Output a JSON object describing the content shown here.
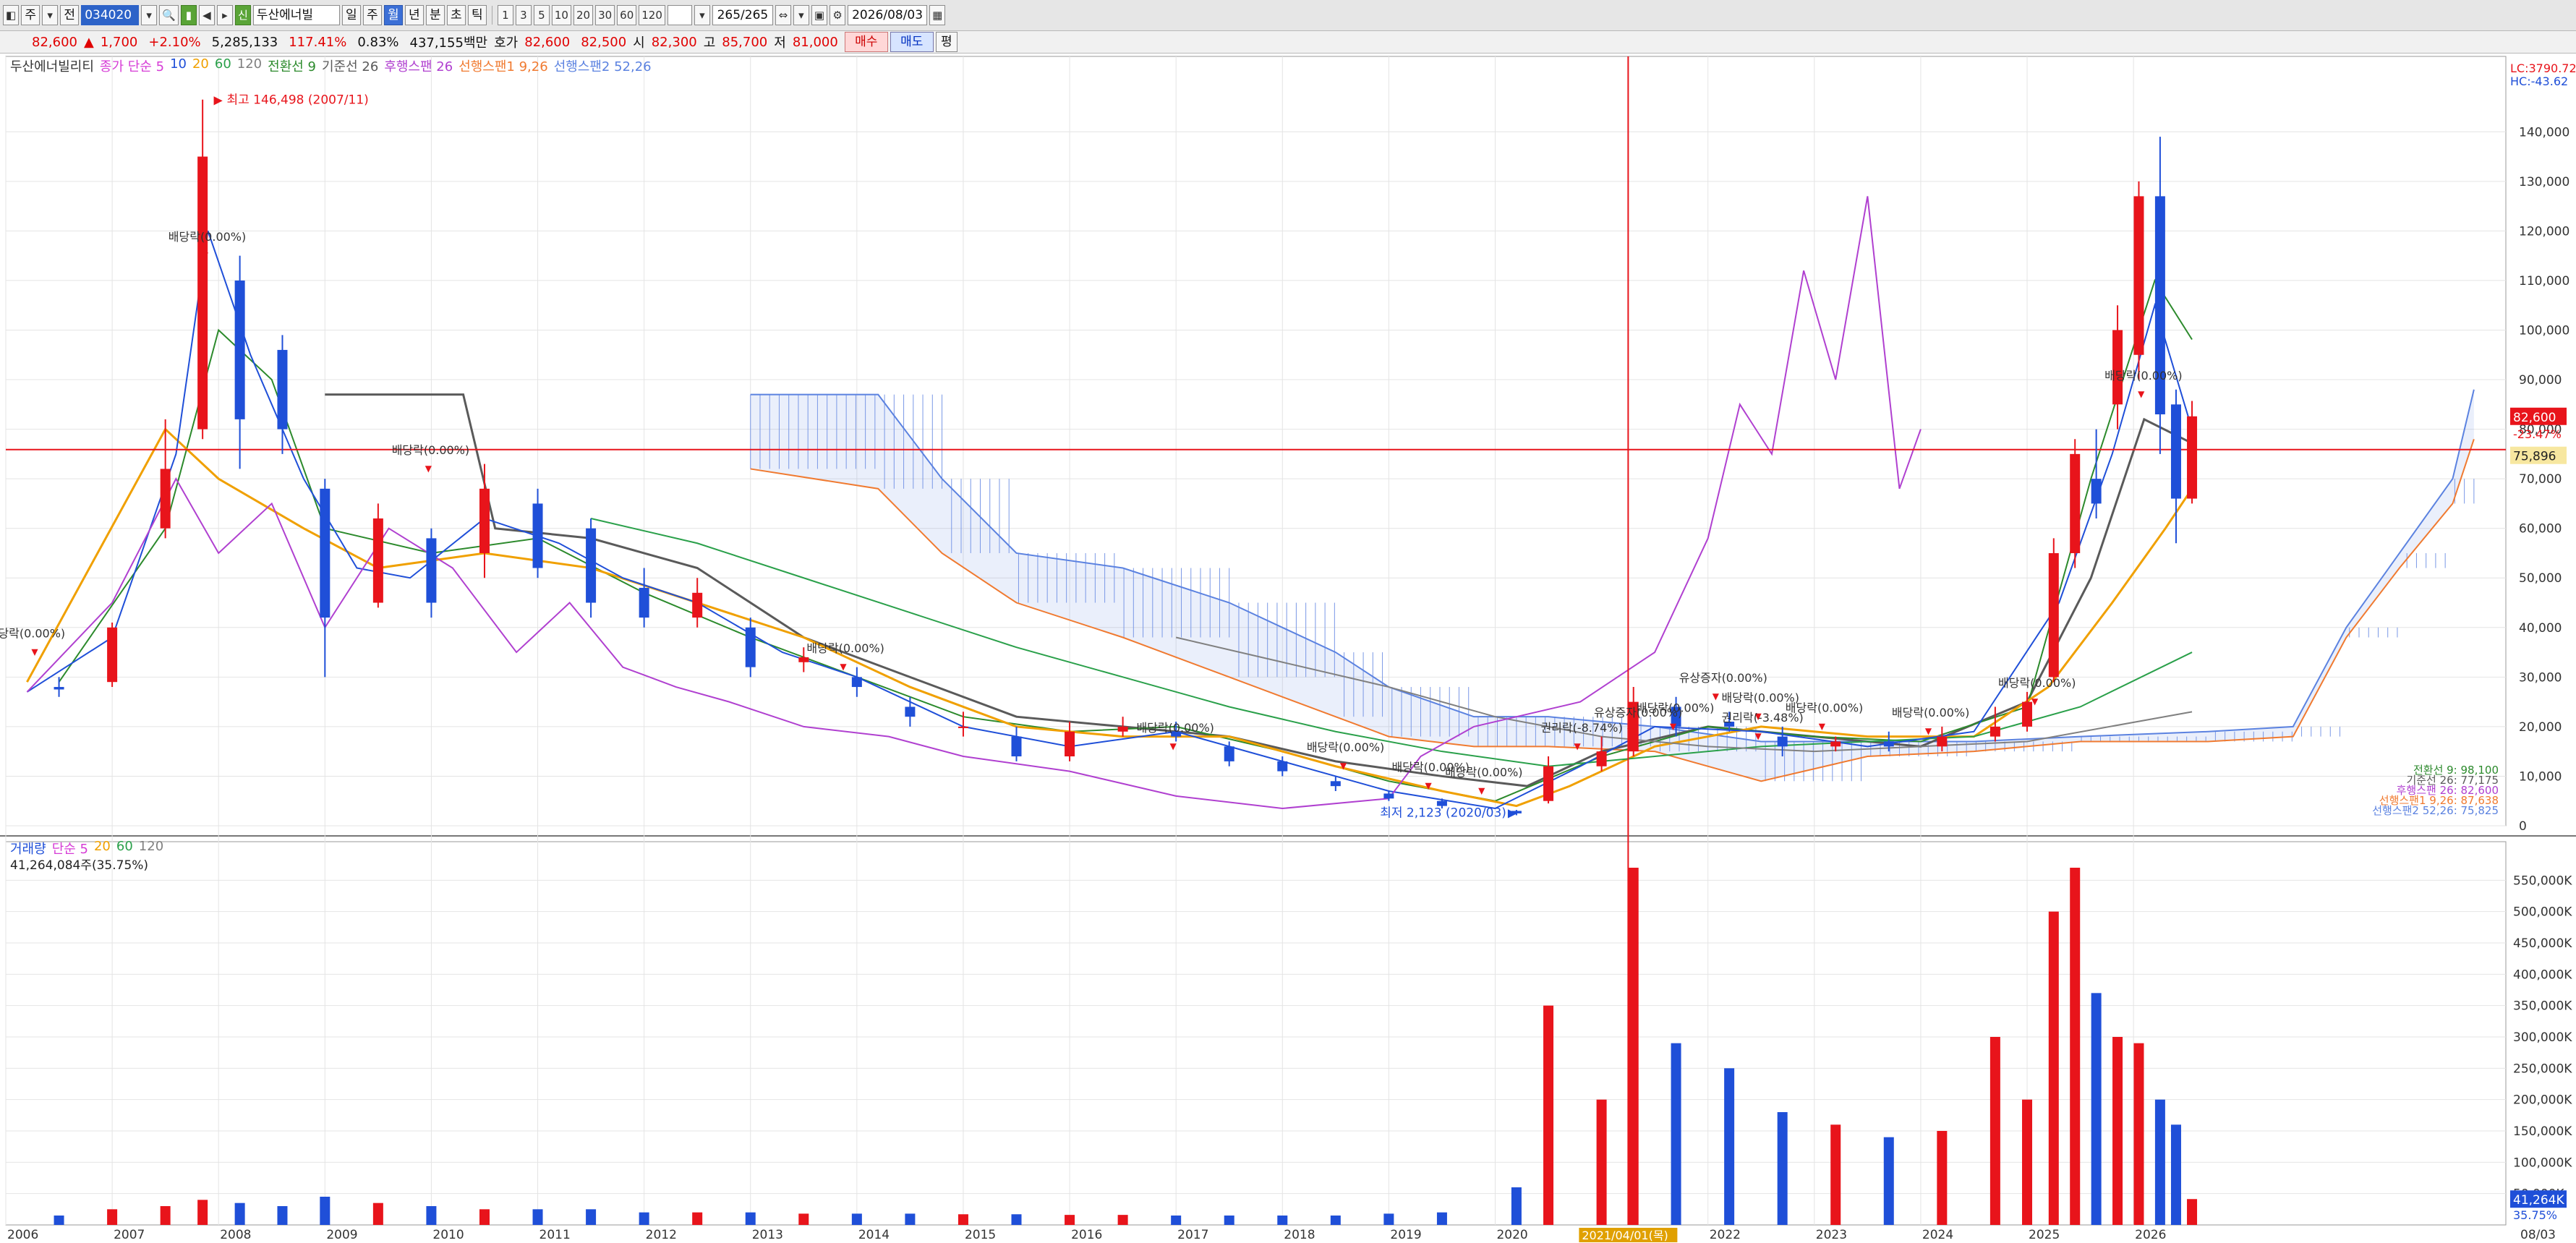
{
  "toolbar": {
    "mode_buttons": [
      "주",
      "전"
    ],
    "code": "034020",
    "name": "두산에너빌",
    "periods": [
      "일",
      "주",
      "월",
      "년",
      "분",
      "초",
      "틱"
    ],
    "active_period": "월",
    "intervals": [
      "1",
      "3",
      "5",
      "10",
      "20",
      "30",
      "60",
      "120"
    ],
    "count": "265/265",
    "date": "2026/08/03"
  },
  "quote": {
    "price": "82,600",
    "arrow": "▲",
    "change": "1,700",
    "change_pct": "+2.10%",
    "volume": "5,285,133",
    "volume_pct": "117.41%",
    "turnover_pct": "0.83%",
    "amount": "437,155백만",
    "ask_label": "호가",
    "ask": "82,600",
    "bid": "82,500",
    "open_label": "시",
    "open": "82,300",
    "high_label": "고",
    "high": "85,700",
    "low_label": "저",
    "low": "81,000",
    "buy": "매수",
    "sell": "매도",
    "flat": "평"
  },
  "legend": {
    "stock": "두산에너빌리티",
    "ma": "종가 단순 5",
    "ma_periods": [
      "10",
      "20",
      "60",
      "120"
    ],
    "conv": "전환선 9",
    "base": "기준선 26",
    "lag": "후행스팬 26",
    "lead1": "선행스팬1 9,26",
    "lead2": "선행스팬2 52,26"
  },
  "price_panel": {
    "lc": "LC:3790.72",
    "hc": "HC:-43.62",
    "current_badge": "82,600",
    "current_pct": "-23.47%",
    "cursor_price": "75,896",
    "high_note": "최고 146,498 (2007/11)",
    "low_note": "최저 2,123 (2020/03)",
    "ichimoku_values": [
      "전환선 9: 98,100",
      "기준선 26: 77,175",
      "후행스팬 26: 82,600",
      "선행스팬1 9,26: 87,638",
      "선행스팬2 52,26: 75,825"
    ],
    "y_ticks": [
      "140,000",
      "130,000",
      "120,000",
      "110,000",
      "100,000",
      "90,000",
      "80,000",
      "70,000",
      "60,000",
      "50,000",
      "40,000",
      "30,000",
      "20,000",
      "10,000",
      "0"
    ],
    "annotations": [
      "배당락(0.00%)",
      "배당락(0.00%)",
      "배당락(0.00%)",
      "배당락(0.00%)",
      "배당락(0.00%)",
      "배당락(0.00%)",
      "배당락(0.00%)",
      "유상증자(0.00%)",
      "유상증자(0.00%)",
      "배당락(0.00%)",
      "배당락(0.00%)",
      "배당락(0.00%)",
      "배당락(0.00%)",
      "배당락(0.00%)",
      "권리락(-3.48%)",
      "권리락(-8.74%)",
      "배당락(0.00%)",
      "당락(0.00%)"
    ]
  },
  "volume_panel": {
    "legend_title": "거래량",
    "legend_ma": "단순 5",
    "legend_periods": [
      "20",
      "60",
      "120"
    ],
    "current": "41,264,084주(35.75%)",
    "badge": "41,264K",
    "badge_pct": "35.75%",
    "y_ticks": [
      "550,000K",
      "500,000K",
      "450,000K",
      "400,000K",
      "350,000K",
      "300,000K",
      "250,000K",
      "200,000K",
      "150,000K",
      "100,000K",
      "50,000K"
    ]
  },
  "x_axis": {
    "years": [
      "2006",
      "2007",
      "2008",
      "2009",
      "2010",
      "2011",
      "2012",
      "2013",
      "2014",
      "2015",
      "2016",
      "2017",
      "2018",
      "2019",
      "2020",
      "2022",
      "2023",
      "2024",
      "2025",
      "2026"
    ],
    "cursor_date": "2021/04/01(목)",
    "end_date": "08/03"
  },
  "chart_data": {
    "type": "candlestick",
    "title": "",
    "period": "monthly",
    "ylim": [
      0,
      145000
    ],
    "volume_ylim": [
      0,
      600000
    ],
    "candles": [
      {
        "x": 2006.5,
        "open": 28000,
        "close": 27500,
        "high": 30000,
        "low": 26000,
        "volume": 15000
      },
      {
        "x": 2007.0,
        "open": 29000,
        "close": 40000,
        "high": 41000,
        "low": 28000,
        "volume": 25000
      },
      {
        "x": 2007.5,
        "open": 60000,
        "close": 72000,
        "high": 82000,
        "low": 58000,
        "volume": 30000
      },
      {
        "x": 2007.85,
        "open": 80000,
        "close": 135000,
        "high": 146498,
        "low": 78000,
        "volume": 40000
      },
      {
        "x": 2008.2,
        "open": 110000,
        "close": 82000,
        "high": 115000,
        "low": 72000,
        "volume": 35000
      },
      {
        "x": 2008.6,
        "open": 96000,
        "close": 80000,
        "high": 99000,
        "low": 75000,
        "volume": 30000
      },
      {
        "x": 2009.0,
        "open": 68000,
        "close": 42000,
        "high": 70000,
        "low": 30000,
        "volume": 45000
      },
      {
        "x": 2009.5,
        "open": 45000,
        "close": 62000,
        "high": 65000,
        "low": 44000,
        "volume": 35000
      },
      {
        "x": 2010.0,
        "open": 58000,
        "close": 45000,
        "high": 60000,
        "low": 42000,
        "volume": 30000
      },
      {
        "x": 2010.5,
        "open": 55000,
        "close": 68000,
        "high": 73000,
        "low": 50000,
        "volume": 25000
      },
      {
        "x": 2011.0,
        "open": 65000,
        "close": 52000,
        "high": 68000,
        "low": 50000,
        "volume": 25000
      },
      {
        "x": 2011.5,
        "open": 60000,
        "close": 45000,
        "high": 62000,
        "low": 42000,
        "volume": 25000
      },
      {
        "x": 2012.0,
        "open": 48000,
        "close": 42000,
        "high": 52000,
        "low": 40000,
        "volume": 20000
      },
      {
        "x": 2012.5,
        "open": 42000,
        "close": 47000,
        "high": 50000,
        "low": 40000,
        "volume": 20000
      },
      {
        "x": 2013.0,
        "open": 40000,
        "close": 32000,
        "high": 42000,
        "low": 30000,
        "volume": 20000
      },
      {
        "x": 2013.5,
        "open": 33000,
        "close": 34000,
        "high": 36000,
        "low": 31000,
        "volume": 18000
      },
      {
        "x": 2014.0,
        "open": 30000,
        "close": 28000,
        "high": 32000,
        "low": 26000,
        "volume": 18000
      },
      {
        "x": 2014.5,
        "open": 24000,
        "close": 22000,
        "high": 26000,
        "low": 20000,
        "volume": 18000
      },
      {
        "x": 2015.0,
        "open": 20000,
        "close": 20000,
        "high": 23000,
        "low": 18000,
        "volume": 17000
      },
      {
        "x": 2015.5,
        "open": 18000,
        "close": 14000,
        "high": 20000,
        "low": 13000,
        "volume": 17000
      },
      {
        "x": 2016.0,
        "open": 14000,
        "close": 19000,
        "high": 21000,
        "low": 13000,
        "volume": 16000
      },
      {
        "x": 2016.5,
        "open": 19000,
        "close": 20000,
        "high": 22000,
        "low": 18000,
        "volume": 16000
      },
      {
        "x": 2017.0,
        "open": 19000,
        "close": 18000,
        "high": 21000,
        "low": 17000,
        "volume": 15000
      },
      {
        "x": 2017.5,
        "open": 16000,
        "close": 13000,
        "high": 17000,
        "low": 12000,
        "volume": 15000
      },
      {
        "x": 2018.0,
        "open": 13000,
        "close": 11000,
        "high": 14000,
        "low": 10000,
        "volume": 15000
      },
      {
        "x": 2018.5,
        "open": 9000,
        "close": 8000,
        "high": 10000,
        "low": 7000,
        "volume": 15000
      },
      {
        "x": 2019.0,
        "open": 6500,
        "close": 5500,
        "high": 7000,
        "low": 5000,
        "volume": 18000
      },
      {
        "x": 2019.5,
        "open": 5000,
        "close": 4000,
        "high": 5500,
        "low": 3500,
        "volume": 20000
      },
      {
        "x": 2020.2,
        "open": 3000,
        "close": 2500,
        "high": 3200,
        "low": 2123,
        "volume": 60000
      },
      {
        "x": 2020.5,
        "open": 5000,
        "close": 12000,
        "high": 14000,
        "low": 4500,
        "volume": 350000
      },
      {
        "x": 2021.0,
        "open": 12000,
        "close": 15000,
        "high": 18000,
        "low": 11000,
        "volume": 200000
      },
      {
        "x": 2021.3,
        "open": 15000,
        "close": 25000,
        "high": 28000,
        "low": 14000,
        "volume": 570000
      },
      {
        "x": 2021.7,
        "open": 24000,
        "close": 20000,
        "high": 26000,
        "low": 18000,
        "volume": 290000
      },
      {
        "x": 2022.2,
        "open": 21000,
        "close": 20000,
        "high": 23000,
        "low": 19000,
        "volume": 250000
      },
      {
        "x": 2022.7,
        "open": 18000,
        "close": 16000,
        "high": 20000,
        "low": 14000,
        "volume": 180000
      },
      {
        "x": 2023.2,
        "open": 16000,
        "close": 17000,
        "high": 18000,
        "low": 15000,
        "volume": 160000
      },
      {
        "x": 2023.7,
        "open": 17000,
        "close": 16000,
        "high": 19000,
        "low": 15000,
        "volume": 140000
      },
      {
        "x": 2024.2,
        "open": 16000,
        "close": 18000,
        "high": 20000,
        "low": 15000,
        "volume": 150000
      },
      {
        "x": 2024.7,
        "open": 18000,
        "close": 20000,
        "high": 24000,
        "low": 17000,
        "volume": 300000
      },
      {
        "x": 2025.0,
        "open": 20000,
        "close": 25000,
        "high": 27000,
        "low": 19000,
        "volume": 200000
      },
      {
        "x": 2025.25,
        "open": 30000,
        "close": 55000,
        "high": 58000,
        "low": 29000,
        "volume": 500000
      },
      {
        "x": 2025.45,
        "open": 55000,
        "close": 75000,
        "high": 78000,
        "low": 52000,
        "volume": 570000
      },
      {
        "x": 2025.65,
        "open": 70000,
        "close": 65000,
        "high": 80000,
        "low": 62000,
        "volume": 370000
      },
      {
        "x": 2025.85,
        "open": 85000,
        "close": 100000,
        "high": 105000,
        "low": 80000,
        "volume": 300000
      },
      {
        "x": 2026.05,
        "open": 95000,
        "close": 127000,
        "high": 130000,
        "low": 90000,
        "volume": 290000
      },
      {
        "x": 2026.25,
        "open": 127000,
        "close": 83000,
        "high": 139000,
        "low": 75000,
        "volume": 200000
      },
      {
        "x": 2026.4,
        "open": 85000,
        "close": 66000,
        "high": 88000,
        "low": 57000,
        "volume": 160000
      },
      {
        "x": 2026.55,
        "open": 66000,
        "close": 82600,
        "high": 85700,
        "low": 65000,
        "volume": 41264
      }
    ]
  },
  "colors": {
    "up": "#e8141b",
    "down": "#1f4fd8",
    "ma5": "#d63cd6",
    "ma10": "#1f4fd8",
    "ma20": "#f0a000",
    "ma60": "#2aa04a",
    "ma120": "#808080",
    "conv": "#2c8a2c",
    "base": "#5a5a5a",
    "lag": "#b040d0",
    "lead1": "#f07a30",
    "lead2": "#5b82e0",
    "cursor": "#e8141b"
  }
}
